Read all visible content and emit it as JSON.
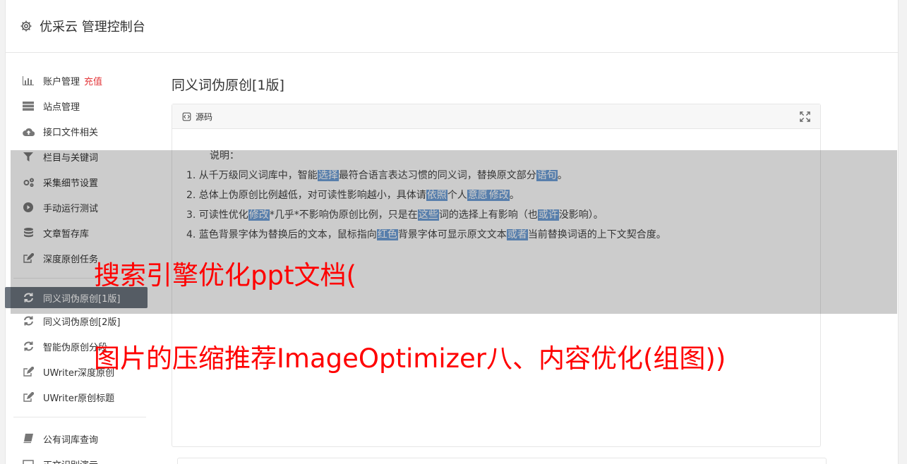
{
  "header": {
    "title": "优采云 管理控制台"
  },
  "sidebar": {
    "group1": [
      {
        "label": "账户管理",
        "badge": "充值",
        "icon": "bar-chart-icon"
      },
      {
        "label": "站点管理",
        "icon": "server-icon"
      },
      {
        "label": "接口文件相关",
        "icon": "cloud-upload-icon"
      },
      {
        "label": "栏目与关键词",
        "icon": "filter-icon"
      },
      {
        "label": "采集细节设置",
        "icon": "cogs-icon"
      },
      {
        "label": "手动运行测试",
        "icon": "play-circle-icon"
      },
      {
        "label": "文章暂存库",
        "icon": "database-icon"
      },
      {
        "label": "深度原创任务",
        "icon": "edit-icon"
      }
    ],
    "group2": [
      {
        "label": "同义词伪原创[1版]",
        "icon": "refresh-icon",
        "active": true
      },
      {
        "label": "同义词伪原创[2版]",
        "icon": "refresh-icon"
      },
      {
        "label": "智能伪原创分段",
        "icon": "refresh-icon"
      },
      {
        "label": "UWriter深度原创",
        "icon": "edit-icon"
      },
      {
        "label": "UWriter原创标题",
        "icon": "edit-icon"
      }
    ],
    "group3": [
      {
        "label": "公有词库查询",
        "icon": "book-icon"
      },
      {
        "label": "正文识别演示",
        "icon": "monitor-icon"
      }
    ]
  },
  "main": {
    "page_title": "同义词伪原创[1版]",
    "panel_title": "源码",
    "intro": "说明：",
    "lines": [
      {
        "parts": [
          "1. 从千万级同义词库中，智能",
          {
            "hl": "选择"
          },
          "最符合语言表达习惯的同义词，替换原文部分",
          {
            "hl": "语句"
          },
          "。"
        ]
      },
      {
        "parts": [
          "2. 总体上伪原创比例越低，对可读性影响越小，具体请",
          {
            "hl": "依照"
          },
          "个人",
          {
            "hl": "意愿"
          },
          {
            "hl": "修改"
          },
          "。"
        ]
      },
      {
        "parts": [
          "3. 可读性优化",
          {
            "hl": "修改"
          },
          "*几乎*不影响伪原创比例，只是在",
          {
            "hl": "这些"
          },
          "词的选择上有影响（也",
          {
            "hl": "或许"
          },
          "没影响）。"
        ]
      },
      {
        "parts": [
          "4. 蓝色背景字体为替换后的文本，鼠标指向",
          {
            "hl": "红色"
          },
          "背景字体可显示原文文本",
          {
            "hl": "或者"
          },
          "当前替换词语的上下文契合度。"
        ]
      }
    ]
  },
  "overlay": {
    "line1": "搜索引擎优化ppt文档(",
    "line2": "图片的压缩推荐ImageOptimizer八、内容优化(组图))"
  },
  "colors": {
    "highlight": "#6f9fd8",
    "active_nav": "#6b737d",
    "recharge": "#e4393c",
    "ad_text": "#ff0000"
  }
}
